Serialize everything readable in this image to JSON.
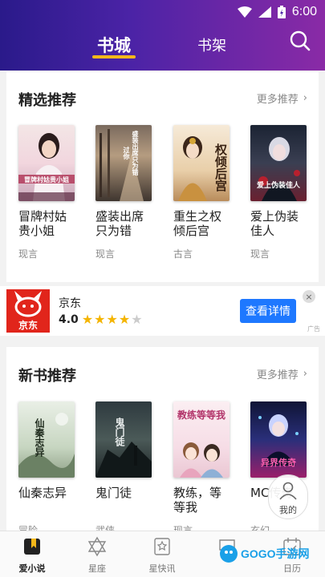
{
  "status_bar": {
    "time": "6:00"
  },
  "header": {
    "tabs": [
      {
        "label": "书城",
        "active": true
      },
      {
        "label": "书架",
        "active": false
      }
    ],
    "accent_color": "#f5b81a"
  },
  "featured": {
    "title": "精选推荐",
    "more_label": "更多推荐",
    "books": [
      {
        "title": "冒牌村姑贵小姐",
        "category": "现言",
        "cover_text": "冒牌村姑贵小姐"
      },
      {
        "title": "盛装出席只为错过你",
        "display_title": "盛装出席只为错过...",
        "category": "现言",
        "cover_text": "盛装出席只为错过你"
      },
      {
        "title": "重生之权倾后宫",
        "category": "古言",
        "cover_text": "权倾后宫"
      },
      {
        "title": "爱上伪装佳人",
        "category": "现言",
        "cover_text": "爱上伪装佳人"
      }
    ]
  },
  "ad": {
    "brand": "京东",
    "logo_text": "京东",
    "rating": "4.0",
    "stars": 4,
    "cta_label": "查看详情",
    "tag": "广告"
  },
  "new_books": {
    "title": "新书推荐",
    "more_label": "更多推荐",
    "books": [
      {
        "title": "仙秦志异",
        "category": "冒险",
        "cover_text": "仙秦志异"
      },
      {
        "title": "鬼门徒",
        "category": "武侠",
        "cover_text": "鬼门徒"
      },
      {
        "title": "教练，等等我",
        "category": "现言",
        "cover_text": "教练等等我"
      },
      {
        "title": "MC传奇",
        "display_title": "MC传奇",
        "category": "玄幻",
        "cover_text": "异界传奇"
      }
    ]
  },
  "floating": {
    "label": "我的"
  },
  "bottom_nav": [
    {
      "label": "爱小说",
      "icon": "book-icon",
      "active": true
    },
    {
      "label": "星座",
      "icon": "star-of-david-icon",
      "active": false
    },
    {
      "label": "星快讯",
      "icon": "news-icon",
      "active": false
    },
    {
      "label": "",
      "icon": "chat-icon",
      "active": false
    },
    {
      "label": "日历",
      "icon": "calendar-icon",
      "active": false
    }
  ],
  "watermark": {
    "text": "GOGO手游网"
  }
}
